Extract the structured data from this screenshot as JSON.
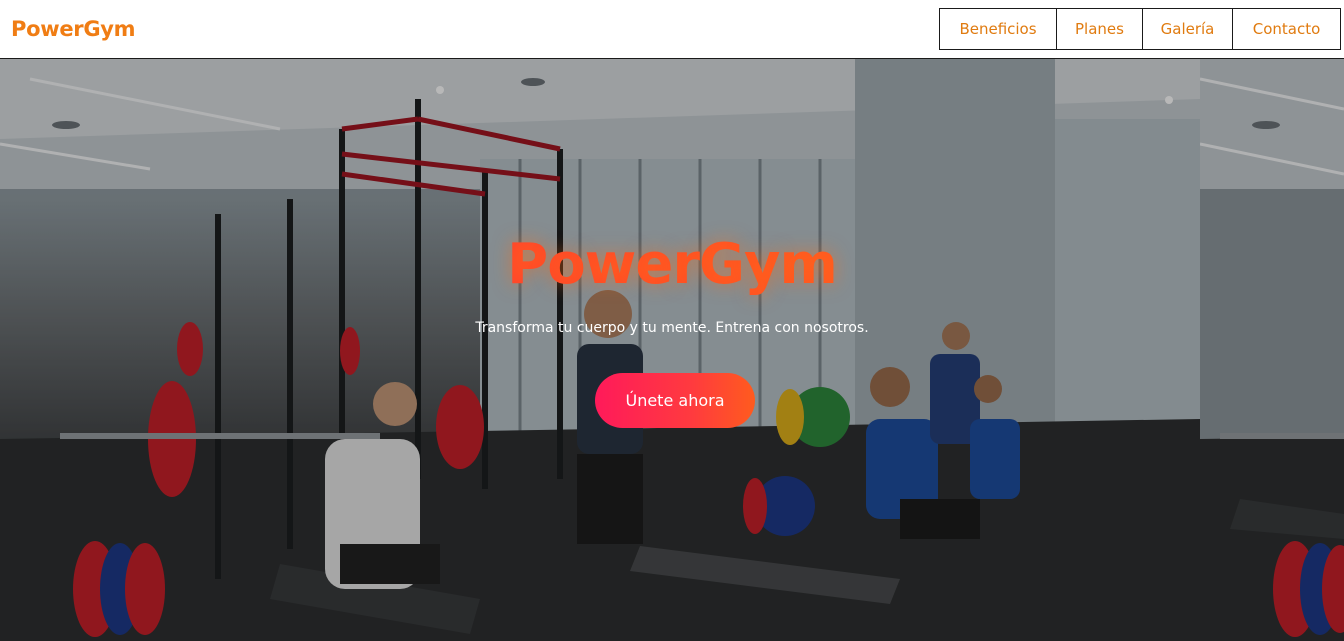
{
  "header": {
    "logo": "PowerGym",
    "nav": [
      {
        "label": "Beneficios"
      },
      {
        "label": "Planes"
      },
      {
        "label": "Galería"
      },
      {
        "label": "Contacto"
      }
    ]
  },
  "hero": {
    "title": "PowerGym",
    "subtitle": "Transforma tu cuerpo y tu mente. Entrena con nosotros.",
    "cta_label": "Únete ahora",
    "background_image": "gym-interior-photo"
  },
  "colors": {
    "brand_orange": "#f07d14",
    "nav_text": "#e07b10",
    "cta_gradient_start": "#ff1a5a",
    "cta_gradient_end": "#ff5b1e"
  }
}
